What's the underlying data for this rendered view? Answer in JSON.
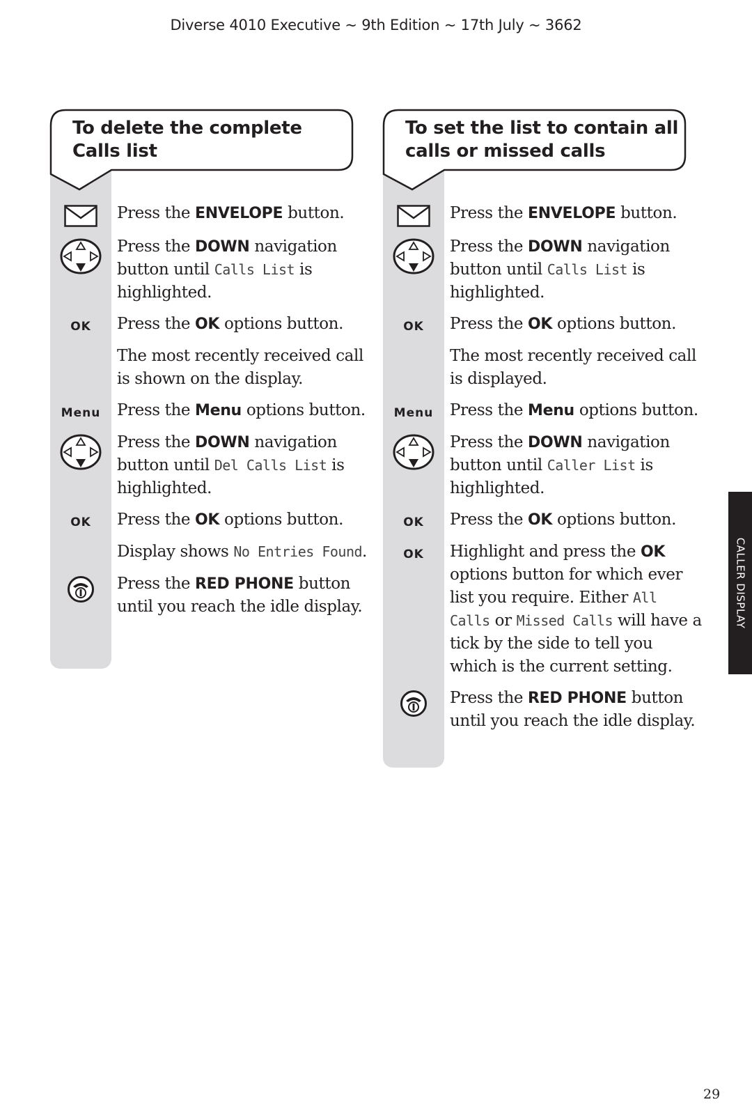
{
  "header": {
    "text": "Diverse 4010 Executive ~ 9th Edition ~ 17th July ~ 3662"
  },
  "side_tab": {
    "label": "CALLER DISPLAY"
  },
  "page_number": "29",
  "sections": [
    {
      "title_line1": "To delete the complete",
      "title_line2": "Calls list",
      "steps": [
        {
          "icon": "envelope-icon",
          "parts": [
            "Press the ",
            "ENVELOPE",
            " button."
          ]
        },
        {
          "icon": "navigation-down-icon",
          "parts": [
            "Press the ",
            "DOWN",
            " navigation button until ",
            "Calls List",
            " is highlighted."
          ]
        },
        {
          "icon": "ok-key",
          "key_label": "OK",
          "parts": [
            "Press the ",
            "OK",
            " options button."
          ]
        },
        {
          "icon": "none",
          "parts": [
            "The most recently received call is shown on the display."
          ]
        },
        {
          "icon": "menu-key",
          "key_label": "Menu",
          "parts": [
            "Press the ",
            "Menu",
            " options button."
          ]
        },
        {
          "icon": "navigation-down-icon",
          "parts": [
            "Press the ",
            "DOWN",
            " navigation button until ",
            "Del Calls List",
            " is highlighted."
          ]
        },
        {
          "icon": "ok-key",
          "key_label": "OK",
          "parts": [
            "Press the ",
            "OK",
            " options button."
          ]
        },
        {
          "icon": "none",
          "parts": [
            "Display shows ",
            "No Entries Found",
            "."
          ]
        },
        {
          "icon": "red-phone-icon",
          "parts": [
            "Press the ",
            "RED PHONE",
            " button until you reach the idle display."
          ]
        }
      ]
    },
    {
      "title_line1": "To set the list to contain all",
      "title_line2": "calls or missed calls",
      "steps": [
        {
          "icon": "envelope-icon",
          "parts": [
            "Press the ",
            "ENVELOPE",
            " button."
          ]
        },
        {
          "icon": "navigation-down-icon",
          "parts": [
            "Press the ",
            "DOWN",
            " navigation button until ",
            "Calls List",
            " is highlighted."
          ]
        },
        {
          "icon": "ok-key",
          "key_label": "OK",
          "parts": [
            "Press the ",
            "OK",
            " options button."
          ]
        },
        {
          "icon": "none",
          "parts": [
            "The most recently received call is displayed."
          ]
        },
        {
          "icon": "menu-key",
          "key_label": "Menu",
          "parts": [
            "Press the ",
            "Menu",
            " options button."
          ]
        },
        {
          "icon": "navigation-down-icon",
          "parts": [
            "Press the ",
            "DOWN",
            " navigation button until ",
            "Caller List",
            " is highlighted."
          ]
        },
        {
          "icon": "ok-key",
          "key_label": "OK",
          "parts": [
            "Press the ",
            "OK",
            " options button."
          ]
        },
        {
          "icon": "ok-key",
          "key_label": "OK",
          "parts": [
            "Highlight and press the ",
            "OK",
            " options button for which ever list you require. Either ",
            "All Calls",
            " or ",
            "Missed Calls",
            " will have a tick by the side to tell you which is the current setting."
          ]
        },
        {
          "icon": "red-phone-icon",
          "parts": [
            "Press the ",
            "RED PHONE",
            " button until you reach the idle display."
          ]
        }
      ]
    }
  ]
}
